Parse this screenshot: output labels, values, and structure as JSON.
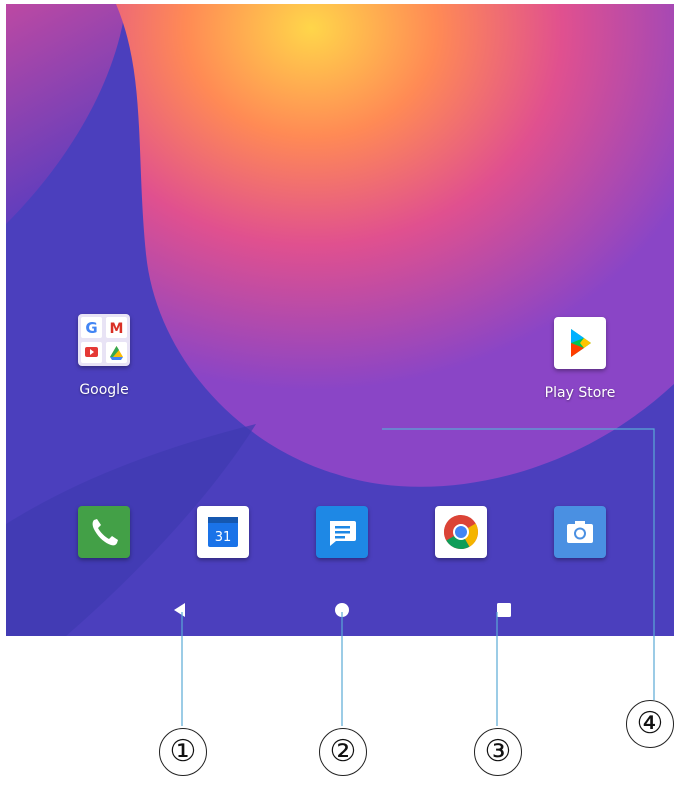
{
  "home_screen": {
    "apps": [
      {
        "label": "Google",
        "icon": "google-folder-icon"
      },
      {
        "label": "Play Store",
        "icon": "play-store-icon"
      }
    ],
    "dock": [
      {
        "icon": "phone-icon"
      },
      {
        "icon": "calendar-icon",
        "text": "31"
      },
      {
        "icon": "messages-icon"
      },
      {
        "icon": "chrome-icon"
      },
      {
        "icon": "camera-icon"
      }
    ],
    "navigation": [
      {
        "icon": "back-icon"
      },
      {
        "icon": "home-icon"
      },
      {
        "icon": "recents-icon"
      }
    ]
  },
  "callouts": [
    "①",
    "②",
    "③",
    "④"
  ],
  "colors": {
    "phone": "#43a047",
    "calendar": "#ffffff",
    "messages": "#1e88e5",
    "camera": "#4a90e2",
    "callout_line": "#5aa9d6"
  }
}
